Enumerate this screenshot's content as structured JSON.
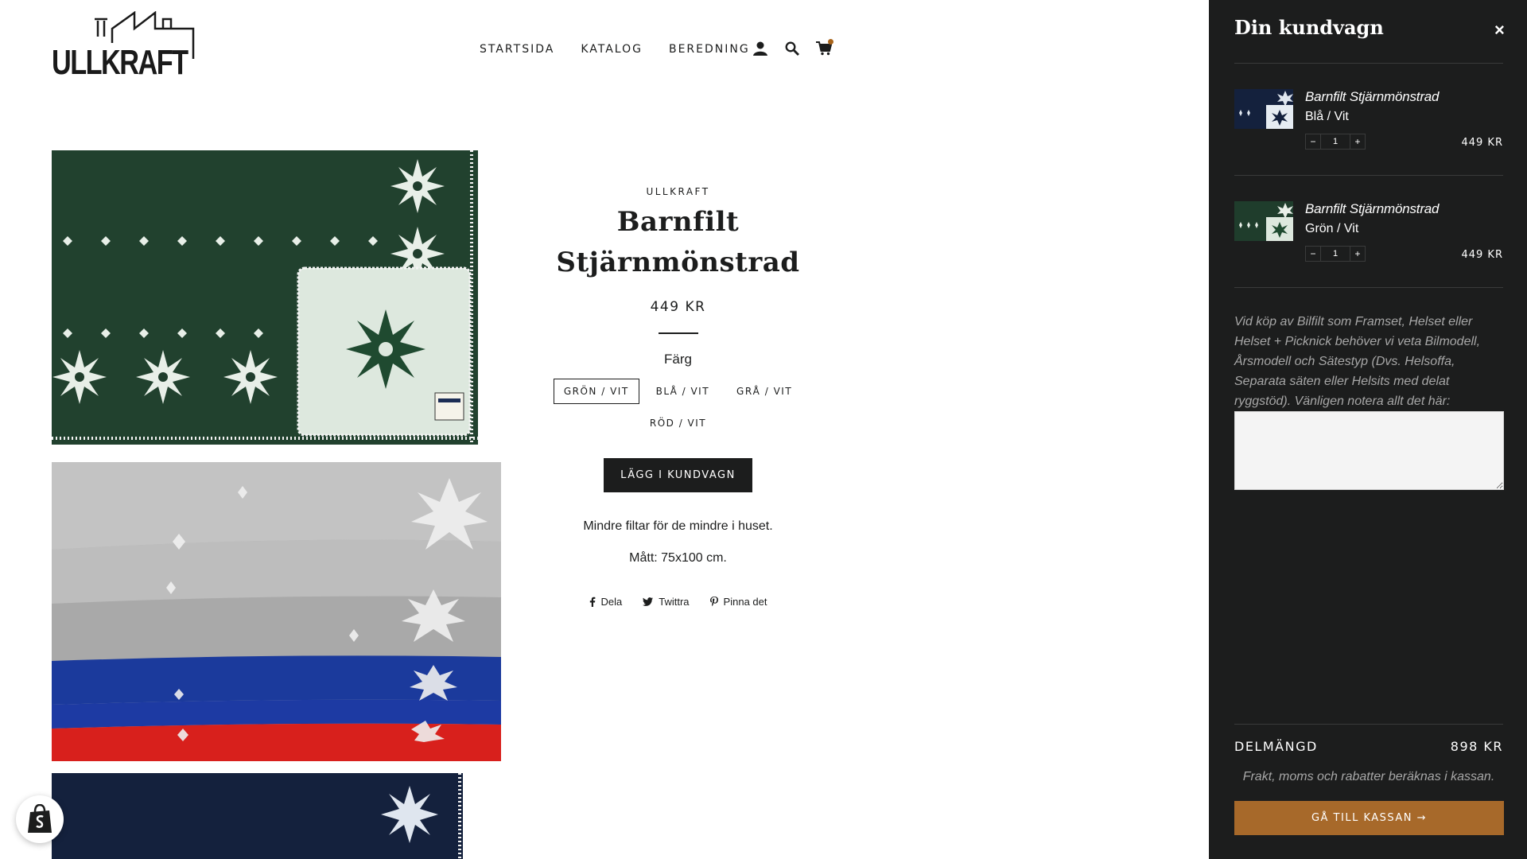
{
  "brand": {
    "logo_text": "ULLKRAFT"
  },
  "nav": {
    "items": [
      {
        "label": "STARTSIDA"
      },
      {
        "label": "KATALOG"
      },
      {
        "label": "BEREDNING"
      }
    ],
    "icons": [
      "account-icon",
      "search-icon",
      "cart-icon"
    ]
  },
  "product": {
    "vendor": "ULLKRAFT",
    "title_line1": "Barnfilt",
    "title_line2": "Stjärnmönstrad",
    "price": "449 KR",
    "option_label": "Färg",
    "variants": [
      {
        "label": "GRÖN / VIT",
        "selected": true
      },
      {
        "label": "BLÅ / VIT",
        "selected": false
      },
      {
        "label": "GRÅ / VIT",
        "selected": false
      },
      {
        "label": "RÖD / VIT",
        "selected": false
      }
    ],
    "add_to_cart": "LÄGG I KUNDVAGN",
    "description": "Mindre filtar för de mindre i huset.",
    "dimensions": "Mått: 75x100 cm.",
    "share": [
      {
        "label": "Dela",
        "icon": "facebook-icon"
      },
      {
        "label": "Twittra",
        "icon": "twitter-icon"
      },
      {
        "label": "Pinna det",
        "icon": "pinterest-icon"
      }
    ]
  },
  "cart": {
    "title": "Din kundvagn",
    "close": "×",
    "items": [
      {
        "name": "Barnfilt Stjärnmönstrad",
        "variant": "Blå / Vit",
        "qty": "1",
        "price": "449 KR",
        "color": "#14213d"
      },
      {
        "name": "Barnfilt Stjärnmönstrad",
        "variant": "Grön / Vit",
        "qty": "1",
        "price": "449 KR",
        "color": "#1f3d2c"
      }
    ],
    "qty_minus": "−",
    "qty_plus": "+",
    "note": "Vid köp av Bilfilt som Framset, Helset eller Helset + Picknick behöver vi veta Bilmodell, Årsmodell och Sätestyp (Dvs. Helsoffa, Separata säten eller Helsits med delat ryggstöd). Vänligen notera allt det här:",
    "note_value": "",
    "subtotal_label": "DELMÄNGD",
    "subtotal_value": "898 KR",
    "shipping_note": "Frakt, moms och rabatter beräknas i kassan.",
    "checkout": "GÅ TILL KASSAN →"
  },
  "colors": {
    "drawer_bg": "#1c1d1d",
    "checkout_bg": "#a7692a",
    "text_dark": "#1c1d1d",
    "cart_dot": "#a8641b"
  }
}
